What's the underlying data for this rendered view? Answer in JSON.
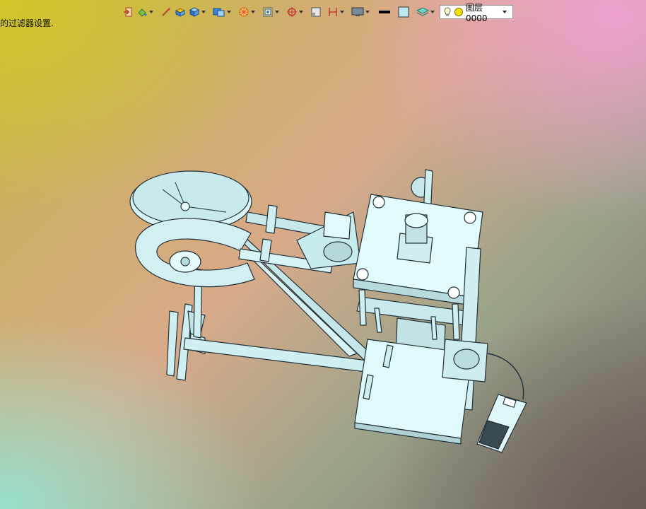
{
  "status": {
    "message": "的过滤器设置."
  },
  "toolbar": {
    "layer": {
      "name": "图层0000"
    }
  },
  "icons": [
    "exit-icon",
    "paint-bucket-icon",
    "brush-icon",
    "box-solid-icon",
    "cube-icon",
    "cube-view-icon",
    "palette-icon",
    "frame-icon",
    "target-icon",
    "square-icon",
    "dimension-icon",
    "monitor-icon",
    "line-weight-icon",
    "color-swatch-icon",
    "layers-icon",
    "lightbulb-icon",
    "yellow-dot-icon"
  ],
  "colors": {
    "model_fill": "#cfeff0",
    "model_edge": "#223038",
    "layer_dot": "#f5e000"
  }
}
